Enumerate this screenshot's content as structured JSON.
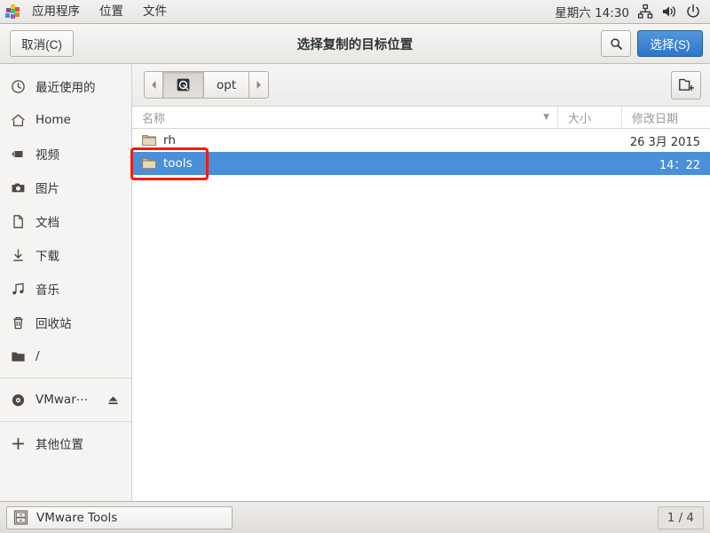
{
  "top_panel": {
    "apps_icon": "applications-grid-icon",
    "menus": [
      "应用程序",
      "位置",
      "文件"
    ],
    "clock": "星期六 14:30",
    "tray": [
      "network-icon",
      "volume-icon",
      "power-icon"
    ]
  },
  "header": {
    "cancel_label": "取消(C)",
    "title": "选择复制的目标位置",
    "search_icon": "search-icon",
    "select_label": "选择(S)",
    "accent_color": "#3c82d4"
  },
  "sidebar": {
    "items": [
      {
        "label": "最近使用的",
        "icon": "clock-icon"
      },
      {
        "label": "Home",
        "icon": "home-icon"
      },
      {
        "label": "视频",
        "icon": "video-icon"
      },
      {
        "label": "图片",
        "icon": "camera-icon"
      },
      {
        "label": "文档",
        "icon": "document-icon"
      },
      {
        "label": "下载",
        "icon": "download-icon"
      },
      {
        "label": "音乐",
        "icon": "music-icon"
      },
      {
        "label": "回收站",
        "icon": "trash-icon"
      },
      {
        "label": "/",
        "icon": "folder-icon"
      }
    ],
    "devices": [
      {
        "label": "VMwar⋯",
        "icon": "disc-icon",
        "eject_icon": "eject-icon"
      }
    ],
    "other": {
      "label": "其他位置",
      "icon": "plus-icon"
    }
  },
  "pathbar": {
    "back_icon": "chevron-left-icon",
    "root_icon": "filesystem-root-icon",
    "current": "opt",
    "forward_icon": "chevron-right-icon",
    "new_folder_icon": "new-folder-icon"
  },
  "columns": {
    "name": "名称",
    "size": "大小",
    "date": "修改日期",
    "sort_arrow": "▼"
  },
  "files": [
    {
      "name": "rh",
      "size": "",
      "date": "26 3月 2015",
      "icon": "folder-icon",
      "selected": false
    },
    {
      "name": "tools",
      "size": "",
      "date": "14：22",
      "icon": "folder-icon",
      "selected": true
    }
  ],
  "annotation": {
    "target": "tools",
    "color": "#f61a0d"
  },
  "taskbar": {
    "window_label": "VMware Tools",
    "window_icon": "file-cabinet-icon",
    "workspace": "1 / 4"
  },
  "selection_color": "#4a90d9"
}
